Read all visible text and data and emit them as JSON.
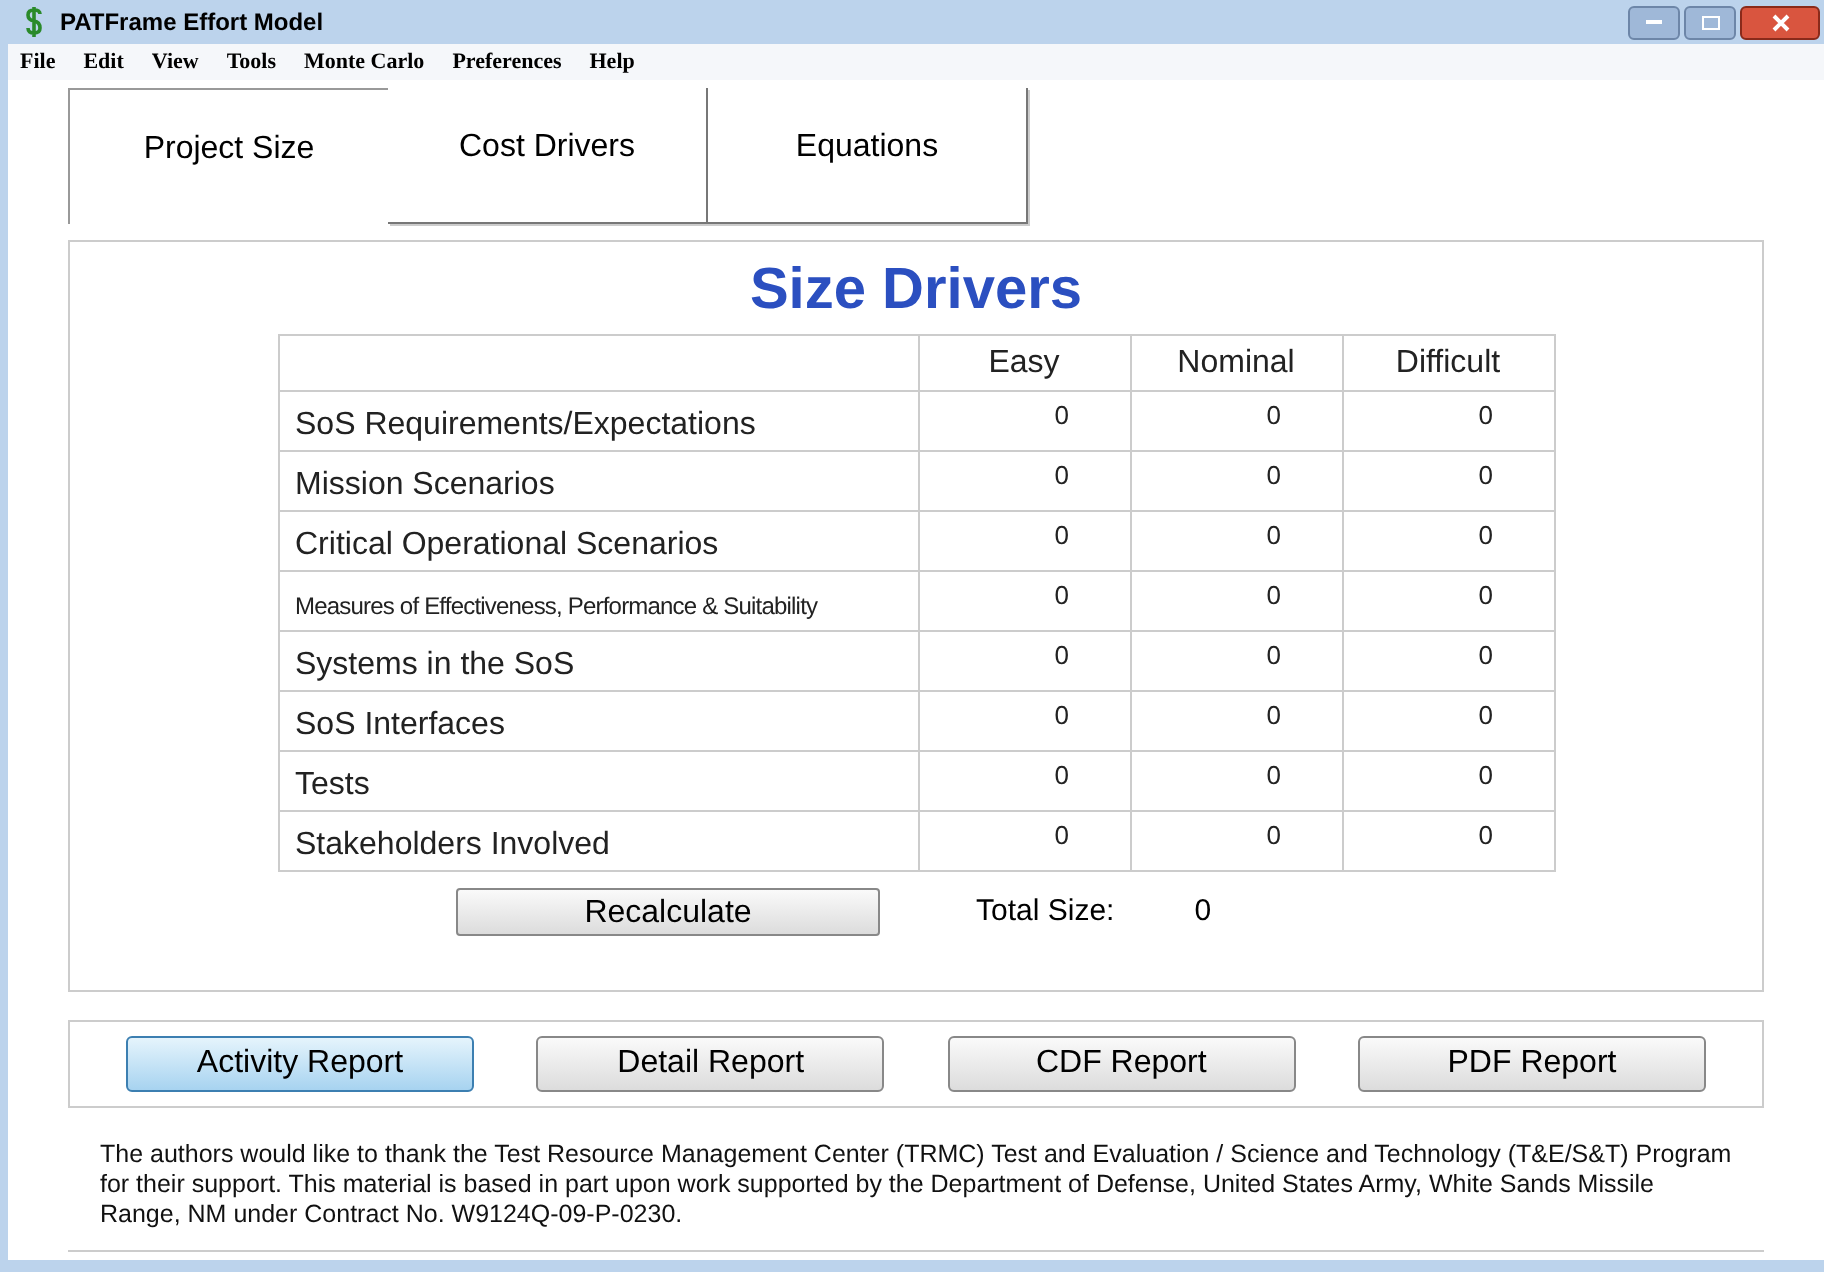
{
  "window": {
    "title": "PATFrame Effort Model"
  },
  "menu": [
    "File",
    "Edit",
    "View",
    "Tools",
    "Monte Carlo",
    "Preferences",
    "Help"
  ],
  "tabs": [
    {
      "label": "Project Size",
      "selected": true
    },
    {
      "label": "Cost Drivers",
      "selected": false
    },
    {
      "label": "Equations",
      "selected": false
    }
  ],
  "panel_title": "Size Drivers",
  "table": {
    "columns": [
      "Easy",
      "Nominal",
      "Difficult"
    ],
    "rows": [
      {
        "name": "SoS Requirements/Expectations",
        "compact": false,
        "values": [
          "0",
          "0",
          "0"
        ]
      },
      {
        "name": "Mission Scenarios",
        "compact": false,
        "values": [
          "0",
          "0",
          "0"
        ]
      },
      {
        "name": "Critical Operational Scenarios",
        "compact": false,
        "values": [
          "0",
          "0",
          "0"
        ]
      },
      {
        "name": "Measures of Effectiveness, Performance & Suitability",
        "compact": true,
        "values": [
          "0",
          "0",
          "0"
        ]
      },
      {
        "name": "Systems in the SoS",
        "compact": false,
        "values": [
          "0",
          "0",
          "0"
        ]
      },
      {
        "name": "SoS Interfaces",
        "compact": false,
        "values": [
          "0",
          "0",
          "0"
        ]
      },
      {
        "name": "Tests",
        "compact": false,
        "values": [
          "0",
          "0",
          "0"
        ]
      },
      {
        "name": "Stakeholders Involved",
        "compact": false,
        "values": [
          "0",
          "0",
          "0"
        ]
      }
    ]
  },
  "recalculate": "Recalculate",
  "total_label": "Total Size:",
  "total_value": "0",
  "reports": [
    {
      "label": "Activity Report",
      "focused": true
    },
    {
      "label": "Detail Report",
      "focused": false
    },
    {
      "label": "CDF Report",
      "focused": false
    },
    {
      "label": "PDF Report",
      "focused": false
    }
  ],
  "footer": "The authors would like to thank the Test Resource Management Center (TRMC) Test and Evaluation / Science and Technology (T&E/S&T) Program for their support. This material is based in part upon work supported by the Department of Defense, United States Army, White Sands Missile Range, NM under Contract No. W9124Q-09-P-0230."
}
